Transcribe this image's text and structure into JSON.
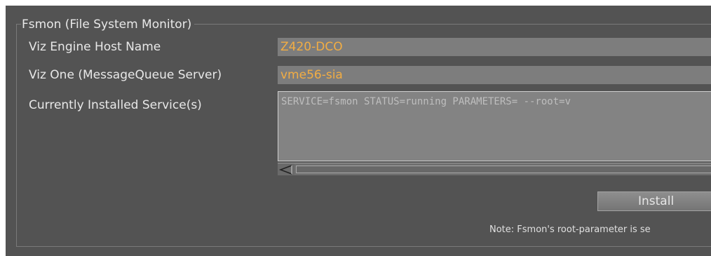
{
  "group": {
    "title": "Fsmon (File System Monitor)"
  },
  "fields": {
    "host_label": "Viz Engine Host Name",
    "host_value": "Z420-DCO",
    "mq_label": "Viz One (MessageQueue Server)",
    "mq_value": "vme56-sia",
    "services_label": "Currently Installed Service(s)",
    "services_value": "SERVICE=fsmon STATUS=running PARAMETERS= --root=v"
  },
  "actions": {
    "install_label": "Install"
  },
  "note": "Note: Fsmon's root-parameter is se",
  "colors": {
    "panel": "#535353",
    "field": "#7d7d7d",
    "value_text": "#f2ad43"
  },
  "icons": {
    "scroll_left": "triangle-left"
  }
}
